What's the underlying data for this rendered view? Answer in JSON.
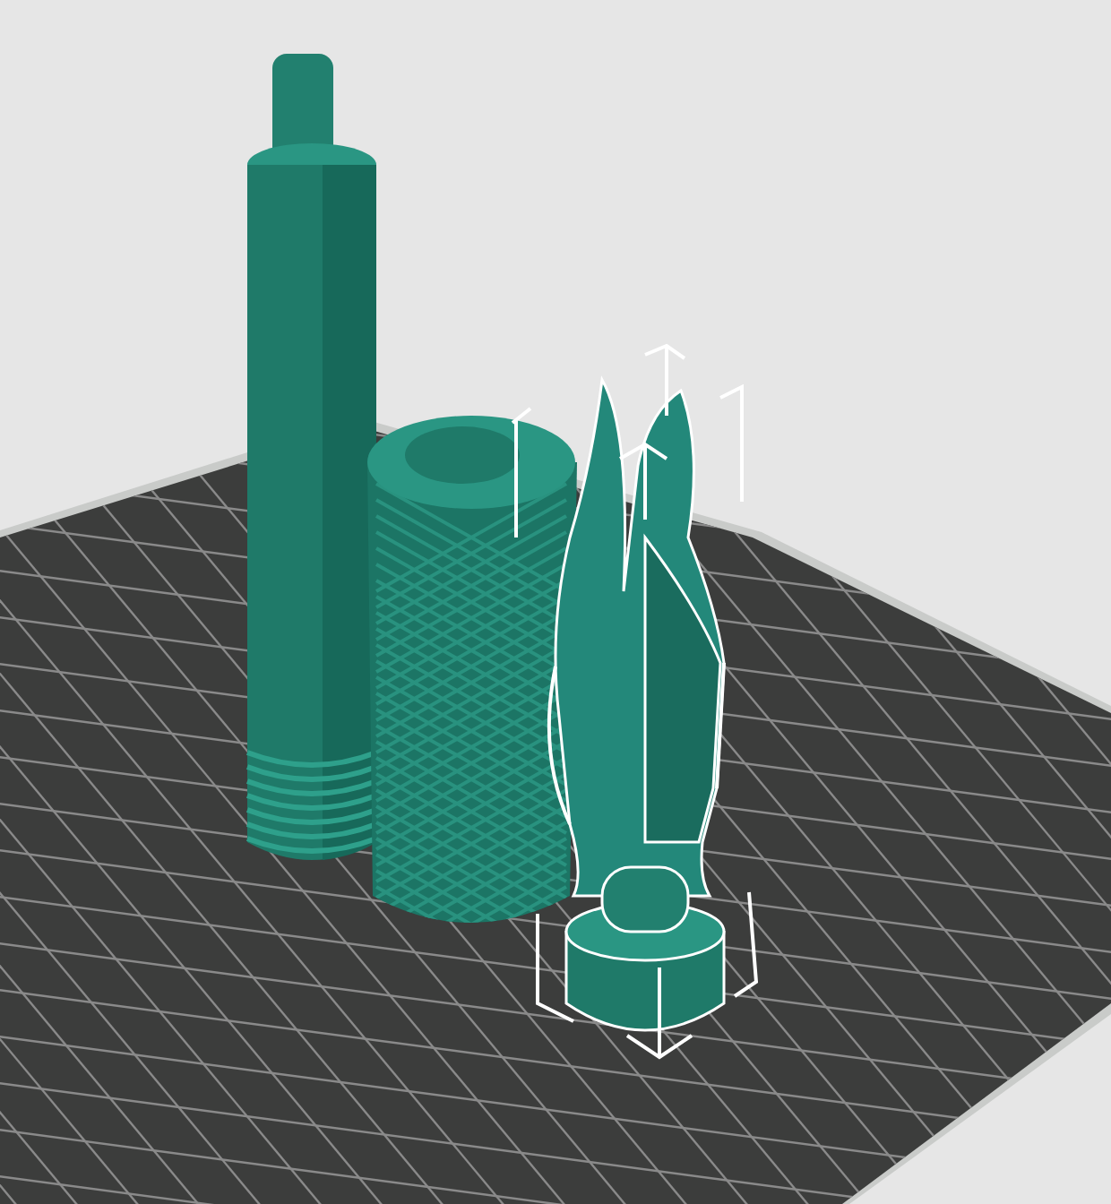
{
  "viewport": {
    "objects": [
      {
        "kind": "rod",
        "selected": false
      },
      {
        "kind": "sleeve",
        "selected": false
      },
      {
        "kind": "fork",
        "selected": true
      }
    ]
  }
}
